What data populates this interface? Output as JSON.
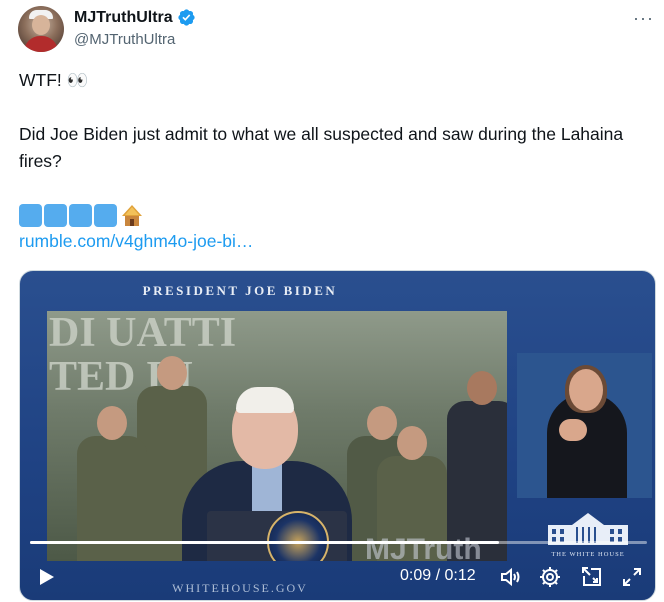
{
  "tweet": {
    "display_name": "MJTruthUltra",
    "handle": "@MJTruthUltra",
    "verified_icon": "verified-badge-icon",
    "more_label": "···",
    "line1": "WTF! 👀",
    "body": "Did Joe Biden just admit to what we all suspected and saw during the Lahaina fires?",
    "link": "rumble.com/v4ghm4o-joe-bi…",
    "accent_color": "#1d9bf0",
    "block_color": "#55acee"
  },
  "video": {
    "title": "PRESIDENT JOE BIDEN",
    "wall_text_1": "DI UATTI",
    "wall_text_2": "TED IN",
    "watermark": "MJTruth",
    "whitehouse_label": "THE WHITE HOUSE",
    "footer_url": "WHITEHOUSE.GOV",
    "current_time": "0:09",
    "separator": "/",
    "duration": "0:12",
    "progress_fraction": 0.76
  }
}
